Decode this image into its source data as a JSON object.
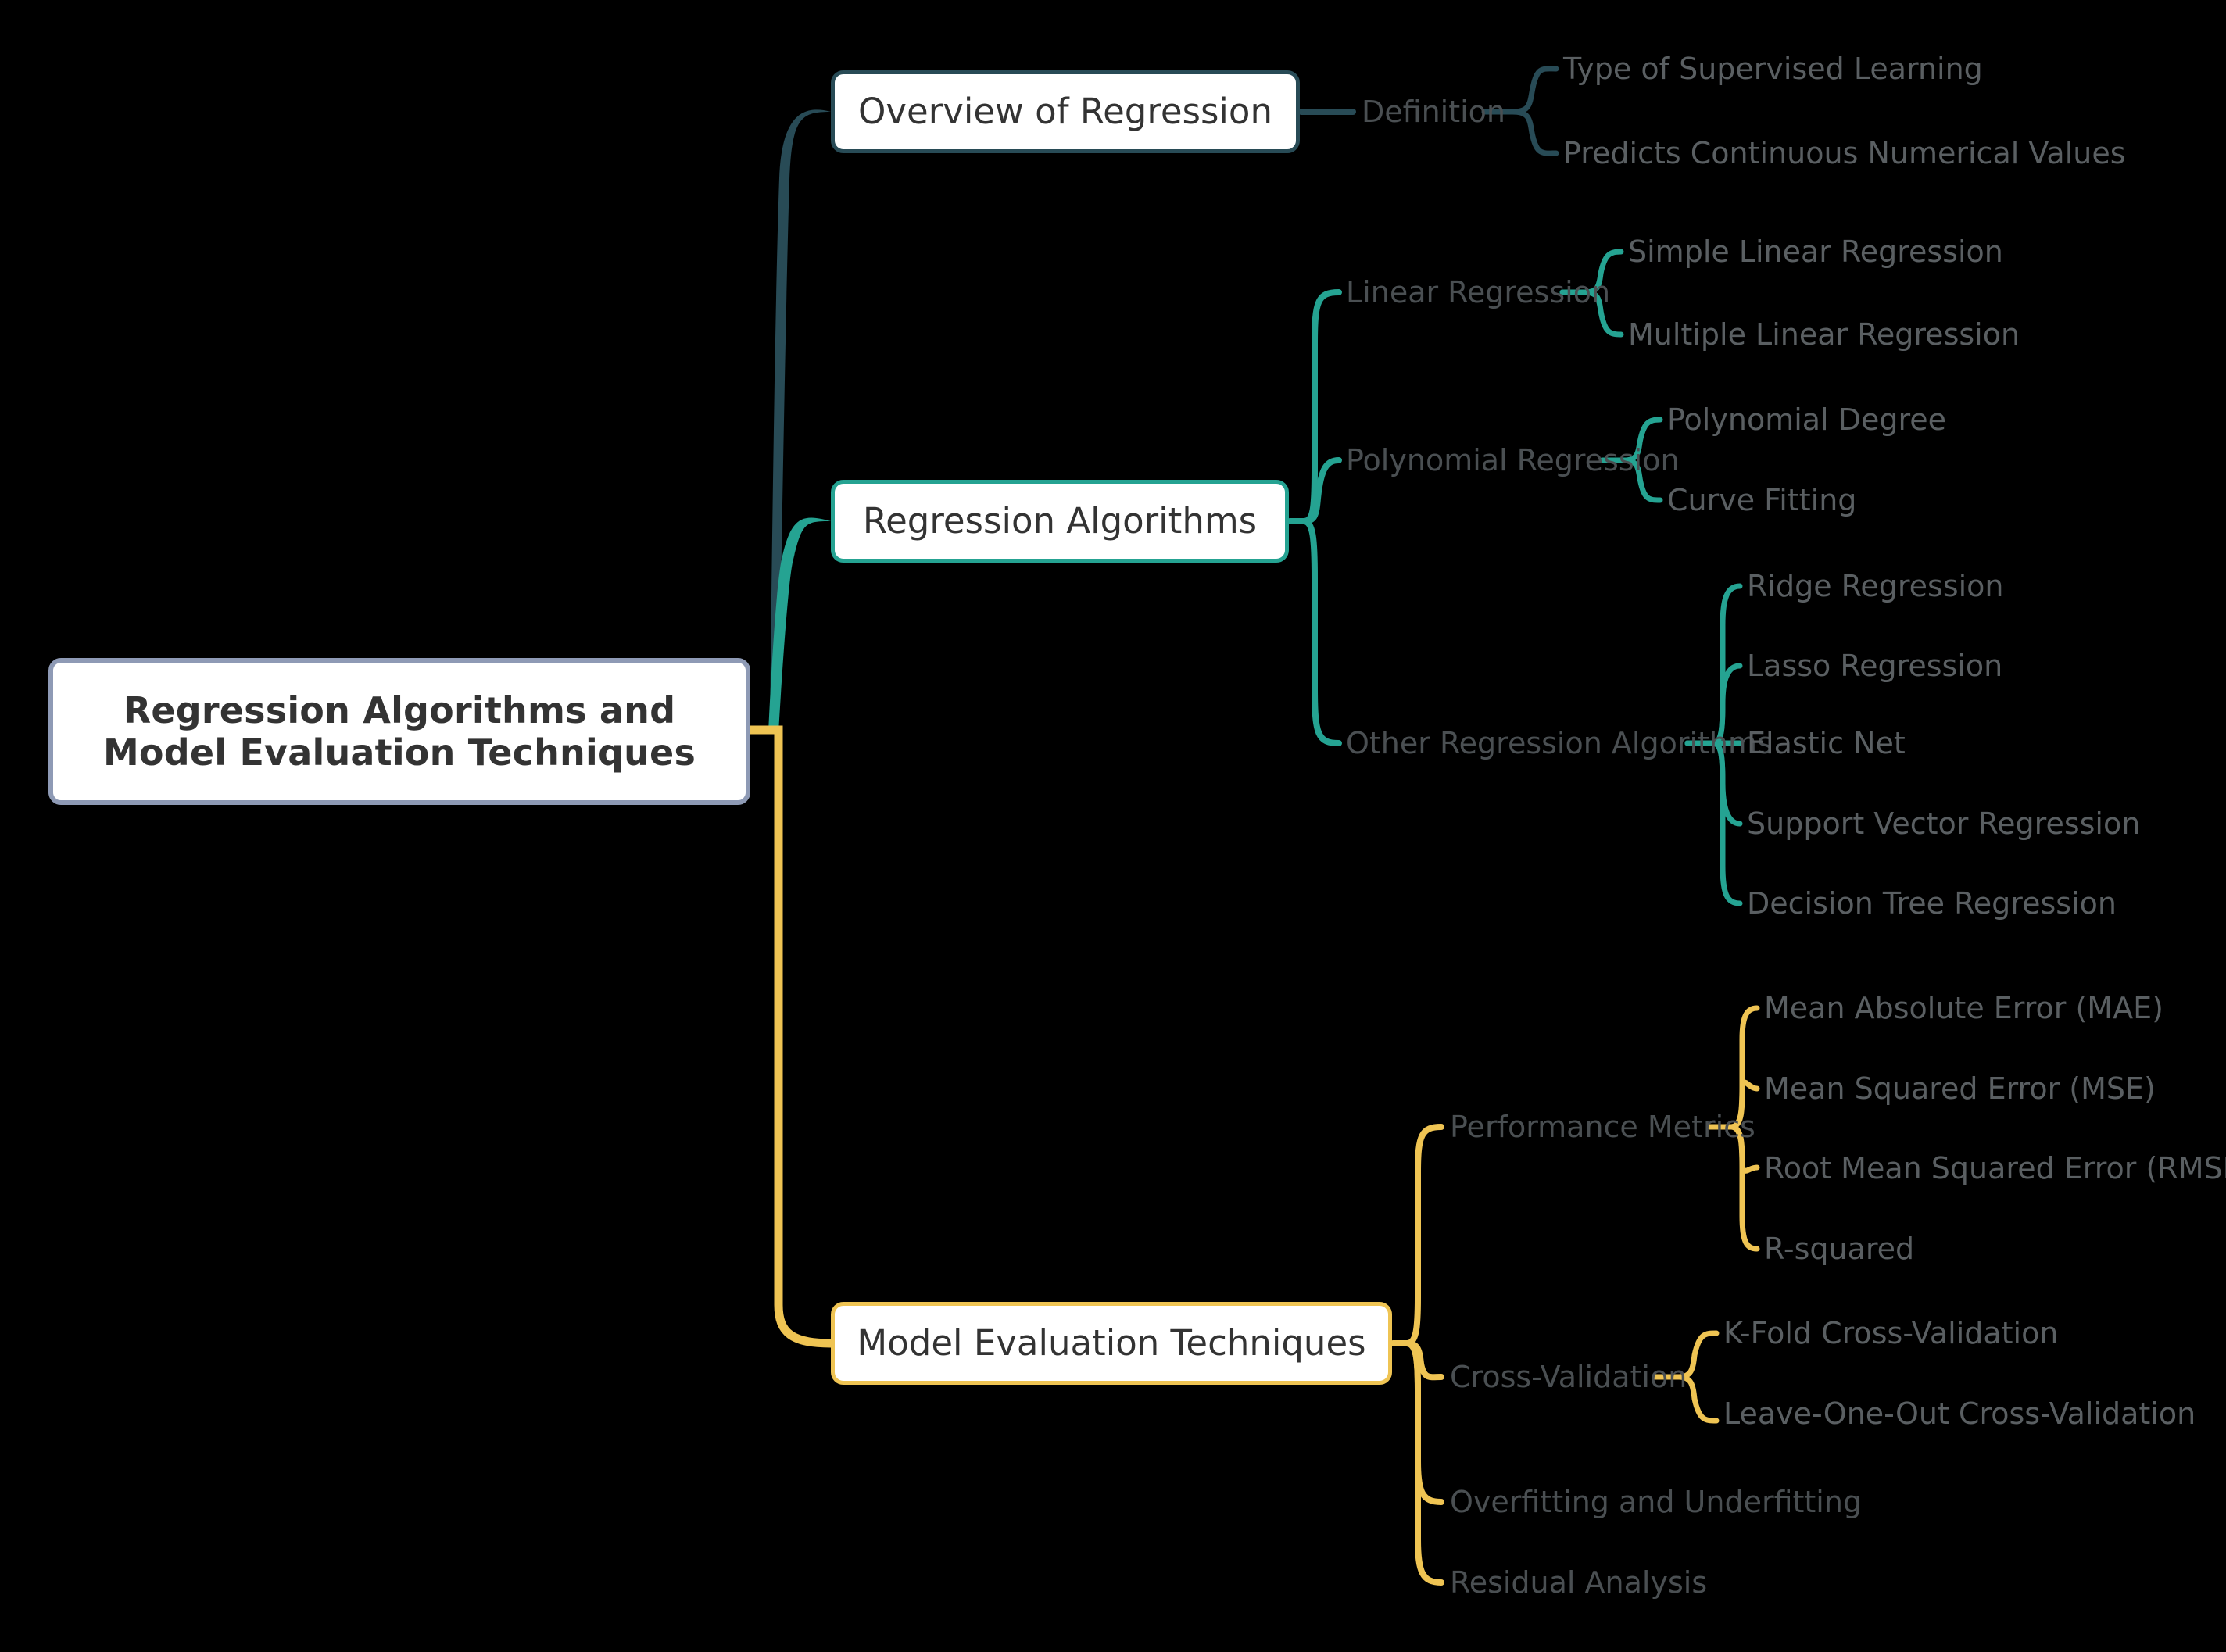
{
  "mindmap": {
    "root": {
      "label": "Regression Algorithms and\nModel Evaluation Techniques",
      "line1": "Regression Algorithms and",
      "line2": "Model Evaluation Techniques",
      "border_color": "#8e9ab5",
      "background": "#ffffff",
      "text_color": "#333333"
    },
    "background_color": "#000000",
    "branches": [
      {
        "id": "overview",
        "label": "Overview of Regression",
        "color": "#284b56",
        "children": [
          {
            "label": "Definition",
            "children": [
              {
                "label": "Type of Supervised Learning"
              },
              {
                "label": "Predicts Continuous Numerical Values"
              }
            ]
          }
        ]
      },
      {
        "id": "algorithms",
        "label": "Regression Algorithms",
        "color": "#25a392",
        "children": [
          {
            "label": "Linear Regression",
            "children": [
              {
                "label": "Simple Linear Regression"
              },
              {
                "label": "Multiple Linear Regression"
              }
            ]
          },
          {
            "label": "Polynomial Regression",
            "children": [
              {
                "label": "Polynomial Degree"
              },
              {
                "label": "Curve Fitting"
              }
            ]
          },
          {
            "label": "Other Regression Algorithms",
            "children": [
              {
                "label": "Ridge Regression"
              },
              {
                "label": "Lasso Regression"
              },
              {
                "label": "Elastic Net"
              },
              {
                "label": "Support Vector Regression"
              },
              {
                "label": "Decision Tree Regression"
              }
            ]
          }
        ]
      },
      {
        "id": "evaluation",
        "label": "Model Evaluation Techniques",
        "color": "#efc453",
        "children": [
          {
            "label": "Performance Metrics",
            "children": [
              {
                "label": "Mean Absolute Error (MAE)"
              },
              {
                "label": "Mean Squared Error (MSE)"
              },
              {
                "label": "Root Mean Squared Error (RMSE)"
              },
              {
                "label": "R-squared"
              }
            ]
          },
          {
            "label": "Cross-Validation",
            "children": [
              {
                "label": "K-Fold Cross-Validation"
              },
              {
                "label": "Leave-One-Out Cross-Validation"
              }
            ]
          },
          {
            "label": "Overfitting and Underfitting",
            "children": []
          },
          {
            "label": "Residual Analysis",
            "children": []
          }
        ]
      }
    ]
  }
}
